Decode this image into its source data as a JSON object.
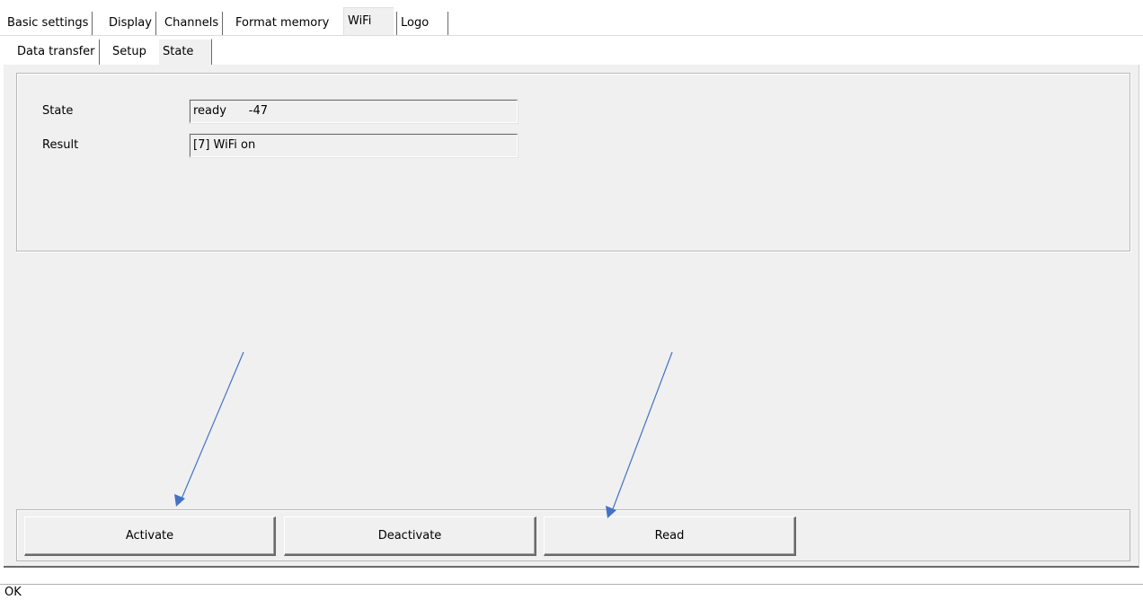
{
  "tabs": [
    {
      "label": "Basic settings"
    },
    {
      "label": "Display"
    },
    {
      "label": "Channels"
    },
    {
      "label": "Format memory"
    },
    {
      "label": "WiFi",
      "active": true
    },
    {
      "label": "Logo"
    }
  ],
  "subtabs": [
    {
      "label": "Data transfer"
    },
    {
      "label": "Setup"
    },
    {
      "label": "State",
      "active": true
    }
  ],
  "state_panel": {
    "state_label": "State",
    "state_value": "ready      -47",
    "result_label": "Result",
    "result_value": "[7] WiFi on"
  },
  "buttons": {
    "activate": "Activate",
    "deactivate": "Deactivate",
    "read": "Read"
  },
  "annotations": {
    "arrow_color": "#4472c4",
    "arrows": [
      "arrow-to-activate",
      "arrow-to-read"
    ]
  },
  "statusbar": {
    "text": "OK"
  }
}
